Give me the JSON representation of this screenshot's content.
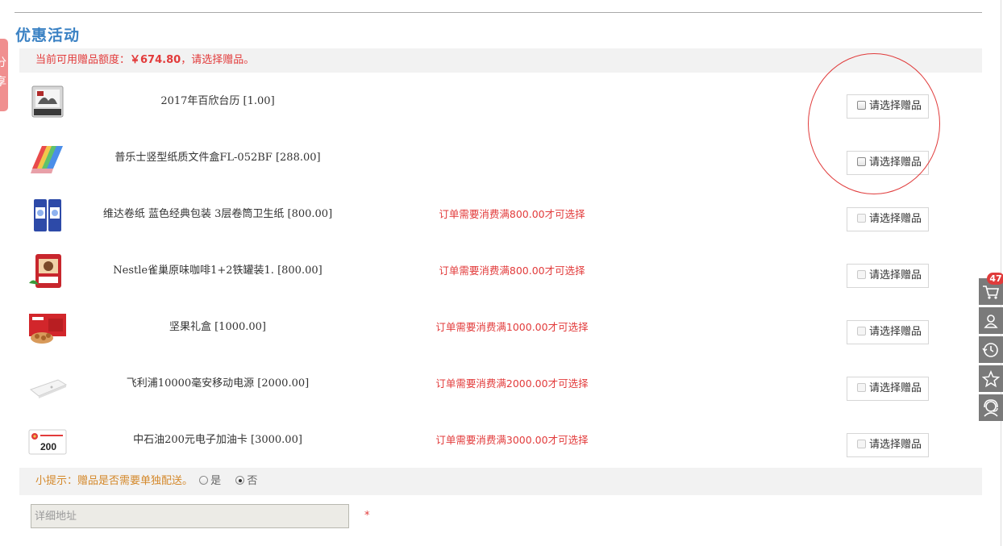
{
  "section": {
    "title": "优惠活动"
  },
  "left_tab": {
    "chars": [
      "分",
      "享"
    ]
  },
  "notice": {
    "prefix": "当前可用赠品额度：",
    "amount": "￥674.80",
    "suffix": "，请选择赠品。"
  },
  "gifts": [
    {
      "name": "2017年百欣台历 [1.00]",
      "note": "",
      "select_label": "请选择赠品",
      "enabled": true,
      "thumb": "calendar-thumb"
    },
    {
      "name": "普乐士竖型纸质文件盒FL-052BF [288.00]",
      "note": "",
      "select_label": "请选择赠品",
      "enabled": true,
      "thumb": "file-box-thumb"
    },
    {
      "name": "维达卷纸 蓝色经典包装 3层卷筒卫生纸 [800.00]",
      "note": "订单需要消费满800.00才可选择",
      "select_label": "请选择赠品",
      "enabled": false,
      "thumb": "tissue-thumb"
    },
    {
      "name": "Nestle雀巢原味咖啡1+2铁罐装1. [800.00]",
      "note": "订单需要消费满800.00才可选择",
      "select_label": "请选择赠品",
      "enabled": false,
      "thumb": "coffee-thumb"
    },
    {
      "name": "坚果礼盒 [1000.00]",
      "note": "订单需要消费满1000.00才可选择",
      "select_label": "请选择赠品",
      "enabled": false,
      "thumb": "nut-box-thumb"
    },
    {
      "name": "飞利浦10000毫安移动电源 [2000.00]",
      "note": "订单需要消费满2000.00才可选择",
      "select_label": "请选择赠品",
      "enabled": false,
      "thumb": "power-bank-thumb"
    },
    {
      "name": "中石油200元电子加油卡 [3000.00]",
      "note": "订单需要消费满3000.00才可选择",
      "select_label": "请选择赠品",
      "enabled": false,
      "thumb": "fuel-card-thumb",
      "card_value": "200"
    }
  ],
  "tip": {
    "text": "小提示：赠品是否需要单独配送。",
    "options": [
      {
        "label": "是",
        "checked": false
      },
      {
        "label": "否",
        "checked": true
      }
    ]
  },
  "address": {
    "placeholder": "详细地址",
    "value": "",
    "required_mark": "*"
  },
  "sidebar": {
    "cart_count": "47",
    "icons": [
      "cart-icon",
      "user-icon",
      "history-icon",
      "star-icon",
      "service-icon"
    ]
  },
  "colors": {
    "accent_blue": "#3b82c4",
    "alert_red": "#e23b3b",
    "tip_orange": "#d4882a",
    "bar_gray": "#f2f2f2",
    "sidebar_gray": "#7a7a7a"
  }
}
